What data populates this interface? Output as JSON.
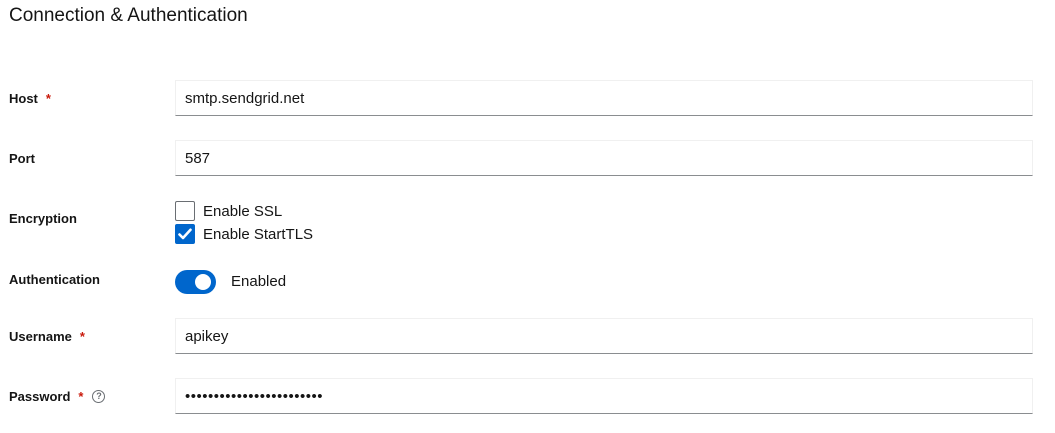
{
  "section": {
    "title": "Connection & Authentication"
  },
  "fields": {
    "host": {
      "label": "Host",
      "required_mark": "*",
      "value": "smtp.sendgrid.net"
    },
    "port": {
      "label": "Port",
      "value": "587"
    },
    "encryption": {
      "label": "Encryption",
      "options": [
        {
          "label": "Enable SSL",
          "checked": false
        },
        {
          "label": "Enable StartTLS",
          "checked": true
        }
      ]
    },
    "authentication": {
      "label": "Authentication",
      "state_label": "Enabled",
      "enabled": true
    },
    "username": {
      "label": "Username",
      "required_mark": "*",
      "value": "apikey"
    },
    "password": {
      "label": "Password",
      "required_mark": "*",
      "value": "••••••••••••••••••••••••"
    }
  },
  "colors": {
    "accent": "#0066cc",
    "required": "#c9190b",
    "input_border": "#8a8d90"
  },
  "icons": {
    "help": "help-circle-icon",
    "check": "checkmark-icon"
  }
}
